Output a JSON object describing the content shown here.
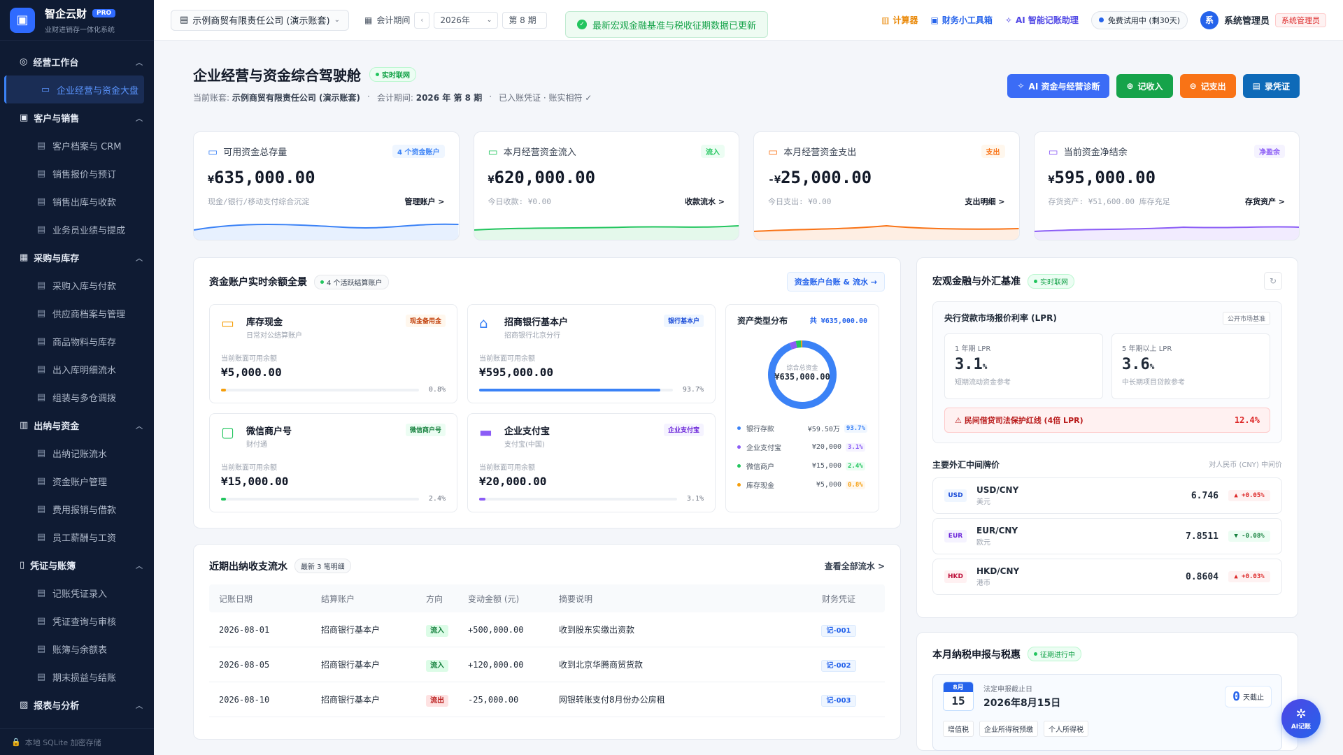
{
  "brand": {
    "title": "智企云财",
    "badge": "PRO",
    "subtitle": "业财进销存一体化系统"
  },
  "sidebar": {
    "groups": [
      {
        "label": "经营工作台",
        "icon": "dashboard-icon",
        "items": [
          {
            "label": "企业经营与资金大盘",
            "icon": "monitor-icon",
            "active": true
          }
        ]
      },
      {
        "label": "客户与销售",
        "icon": "bag-icon",
        "items": [
          {
            "label": "客户档案与 CRM"
          },
          {
            "label": "销售报价与预订"
          },
          {
            "label": "销售出库与收款"
          },
          {
            "label": "业务员业绩与提成"
          }
        ]
      },
      {
        "label": "采购与库存",
        "icon": "box-icon",
        "items": [
          {
            "label": "采购入库与付款"
          },
          {
            "label": "供应商档案与管理"
          },
          {
            "label": "商品物料与库存"
          },
          {
            "label": "出入库明细流水"
          },
          {
            "label": "组装与多仓调拨"
          }
        ]
      },
      {
        "label": "出纳与资金",
        "icon": "cash-icon",
        "items": [
          {
            "label": "出纳记账流水"
          },
          {
            "label": "资金账户管理"
          },
          {
            "label": "费用报销与借款"
          },
          {
            "label": "员工薪酬与工资"
          }
        ]
      },
      {
        "label": "凭证与账簿",
        "icon": "book-icon",
        "items": [
          {
            "label": "记账凭证录入"
          },
          {
            "label": "凭证查询与审核"
          },
          {
            "label": "账簿与余额表"
          },
          {
            "label": "期末损益与结账"
          }
        ]
      },
      {
        "label": "报表与分析",
        "icon": "chart-icon",
        "items": []
      }
    ],
    "footer": "本地 SQLite 加密存储"
  },
  "topbar": {
    "company": "示例商贸有限责任公司 (演示账套)",
    "period_label": "会计期间",
    "year": "2026年",
    "period": "第 8 期",
    "toast": "最新宏观金融基准与税收征期数据已更新",
    "calculator": "计算器",
    "toolbox": "财务小工具箱",
    "ai": "AI 智能记账助理",
    "trial": "免费试用中 (剩30天)",
    "user": "系统管理员",
    "avatar": "系",
    "role": "系统管理员"
  },
  "page": {
    "title": "企业经营与资金综合驾驶舱",
    "live": "实时联网",
    "sub_account_label": "当前账套:",
    "sub_account": "示例商贸有限责任公司 (演示账套)",
    "sub_period_label": "会计期间:",
    "sub_period": "2026 年 第 8 期",
    "sub_status": "已入账凭证 · 账实相符",
    "buttons": {
      "ai": "AI 资金与经营诊断",
      "income": "记收入",
      "expense": "记支出",
      "voucher": "录凭证"
    }
  },
  "kpis": [
    {
      "label": "可用资金总存量",
      "tag": "4 个资金账户",
      "currency": "¥",
      "value": "635,000.00",
      "foot": "现金/银行/移动支付综合沉淀",
      "link": "管理账户 >",
      "color": "#3b82f6",
      "tagbg": "#eff6ff",
      "icon": "wallet-icon"
    },
    {
      "label": "本月经营资金流入",
      "tag": "流入",
      "currency": "¥",
      "value": "620,000.00",
      "foot": "今日收款: ¥0.00",
      "link": "收款流水 >",
      "color": "#22c55e",
      "tagbg": "#ecfdf3",
      "icon": "trend-up-icon"
    },
    {
      "label": "本月经营资金支出",
      "tag": "支出",
      "currency": "-¥",
      "value": "25,000.00",
      "foot": "今日支出: ¥0.00",
      "link": "支出明细 >",
      "color": "#f97316",
      "tagbg": "#fff7ed",
      "icon": "card-icon"
    },
    {
      "label": "当前资金净结余",
      "tag": "净盈余",
      "currency": "¥",
      "value": "595,000.00",
      "foot": "存货资产: ¥51,600.00 库存充足",
      "link": "存货资产 >",
      "color": "#8b5cf6",
      "tagbg": "#f5f3ff",
      "icon": "bar-chart-icon"
    }
  ],
  "accounts_panel": {
    "title": "资金账户实时余额全景",
    "chip": "4 个活跃结算账户",
    "link": "资金账户台账 & 流水 →",
    "balance_label": "当前账面可用余额",
    "accounts": [
      {
        "name": "库存现金",
        "sub": "日常对公结算账户",
        "tag": "现金备用金",
        "value": "¥5,000.00",
        "pct": "0.8%",
        "ratio": 0.008,
        "color": "#f59e0b",
        "tagbg": "#fff7ed",
        "tagcolor": "#c2410c",
        "icon": "cash-icon"
      },
      {
        "name": "招商银行基本户",
        "sub": "招商银行北京分行",
        "tag": "银行基本户",
        "value": "¥595,000.00",
        "pct": "93.7%",
        "ratio": 0.937,
        "color": "#3b82f6",
        "tagbg": "#eff6ff",
        "tagcolor": "#1d4ed8",
        "icon": "bank-icon"
      },
      {
        "name": "微信商户号",
        "sub": "财付通",
        "tag": "微信商户号",
        "value": "¥15,000.00",
        "pct": "2.4%",
        "ratio": 0.024,
        "color": "#22c55e",
        "tagbg": "#ecfdf3",
        "tagcolor": "#15803d",
        "icon": "wechat-icon"
      },
      {
        "name": "企业支付宝",
        "sub": "支付宝(中国)",
        "tag": "企业支付宝",
        "value": "¥20,000.00",
        "pct": "3.1%",
        "ratio": 0.031,
        "color": "#8b5cf6",
        "tagbg": "#f5f3ff",
        "tagcolor": "#6d28d9",
        "icon": "alipay-icon"
      }
    ],
    "dist": {
      "title": "资产类型分布",
      "total": "共 ¥635,000.00",
      "center_label": "综合总资金",
      "center_value": "¥635,000.00",
      "items": [
        {
          "name": "银行存款",
          "value": "¥59.50万",
          "pct": "93.7%",
          "ratio": 0.937,
          "color": "#3b82f6",
          "bg": "#eff6ff"
        },
        {
          "name": "企业支付宝",
          "value": "¥20,000",
          "pct": "3.1%",
          "ratio": 0.031,
          "color": "#8b5cf6",
          "bg": "#f5f3ff"
        },
        {
          "name": "微信商户",
          "value": "¥15,000",
          "pct": "2.4%",
          "ratio": 0.024,
          "color": "#22c55e",
          "bg": "#ecfdf3"
        },
        {
          "name": "库存现金",
          "value": "¥5,000",
          "pct": "0.8%",
          "ratio": 0.008,
          "color": "#f59e0b",
          "bg": "#fff7ed"
        }
      ]
    }
  },
  "flow_panel": {
    "title": "近期出纳收支流水",
    "chip": "最新 3 笔明细",
    "link": "查看全部流水 >",
    "headers": [
      "记账日期",
      "结算账户",
      "方向",
      "变动金额 (元)",
      "摘要说明",
      "财务凭证"
    ],
    "rows": [
      {
        "date": "2026-08-01",
        "account": "招商银行基本户",
        "dir": "流入",
        "amount": "+500,000.00",
        "memo": "收到股东实缴出资款",
        "voucher": "记-001",
        "in": true
      },
      {
        "date": "2026-08-05",
        "account": "招商银行基本户",
        "dir": "流入",
        "amount": "+120,000.00",
        "memo": "收到北京华腾商贸货款",
        "voucher": "记-002",
        "in": true
      },
      {
        "date": "2026-08-10",
        "account": "招商银行基本户",
        "dir": "流出",
        "amount": "-25,000.00",
        "memo": "网银转账支付8月份办公房租",
        "voucher": "记-003",
        "in": false
      }
    ]
  },
  "macro_panel": {
    "title": "宏观金融与外汇基准",
    "chip": "实时联网",
    "lpr_title": "央行贷款市场报价利率 (LPR)",
    "lpr_tag": "公开市场基准",
    "lpr": [
      {
        "label": "1 年期 LPR",
        "value": "3.1",
        "unit": "%",
        "sub": "短期流动资金参考"
      },
      {
        "label": "5 年期以上 LPR",
        "value": "3.6",
        "unit": "%",
        "sub": "中长期项目贷款参考"
      }
    ],
    "redline": "民间借贷司法保护红线 (4倍 LPR)",
    "redline_value": "12.4%",
    "fx_title": "主要外汇中间牌价",
    "fx_note": "对人民币 (CNY) 中间价",
    "fx": [
      {
        "code": "USD",
        "pair": "USD/CNY",
        "name": "美元",
        "rate": "6.746",
        "change": "▲ +0.05%",
        "up": true,
        "bg": "#eff6ff",
        "color": "#1d4ed8"
      },
      {
        "code": "EUR",
        "pair": "EUR/CNY",
        "name": "欧元",
        "rate": "7.8511",
        "change": "▼ -0.08%",
        "up": false,
        "bg": "#f5f3ff",
        "color": "#6d28d9"
      },
      {
        "code": "HKD",
        "pair": "HKD/CNY",
        "name": "港币",
        "rate": "0.8604",
        "change": "▲ +0.03%",
        "up": true,
        "bg": "#fff1f2",
        "color": "#be123c"
      }
    ]
  },
  "tax_panel": {
    "title": "本月纳税申报与税惠",
    "chip": "征期进行中",
    "month": "8月",
    "day": "15",
    "deadline_label": "法定申报截止日",
    "deadline": "2026年8月15日",
    "days_left": "0",
    "days_unit": "天截止",
    "tags": [
      "增值税",
      "企业所得税预缴",
      "个人所得税"
    ]
  },
  "fab": "AI记账"
}
